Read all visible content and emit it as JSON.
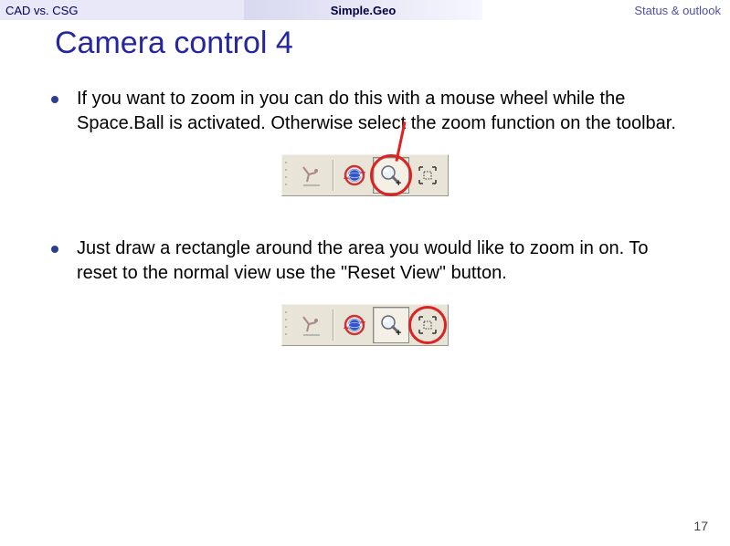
{
  "nav": {
    "left": "CAD vs. CSG",
    "mid": "Simple.Geo",
    "right": "Status & outlook"
  },
  "title": "Camera control 4",
  "bullets": [
    "If you want to zoom in you can do this with a mouse wheel while the Space.Ball is activated. Otherwise select the zoom function on the toolbar.",
    "Just draw a rectangle around the area you would like to zoom in on. To reset to the normal view use the \"Reset View\" button."
  ],
  "icons": {
    "spaceball": "spaceball-icon",
    "rotate": "rotate-icon",
    "zoom": "zoom-icon",
    "reset": "reset-view-icon"
  },
  "page": "17"
}
